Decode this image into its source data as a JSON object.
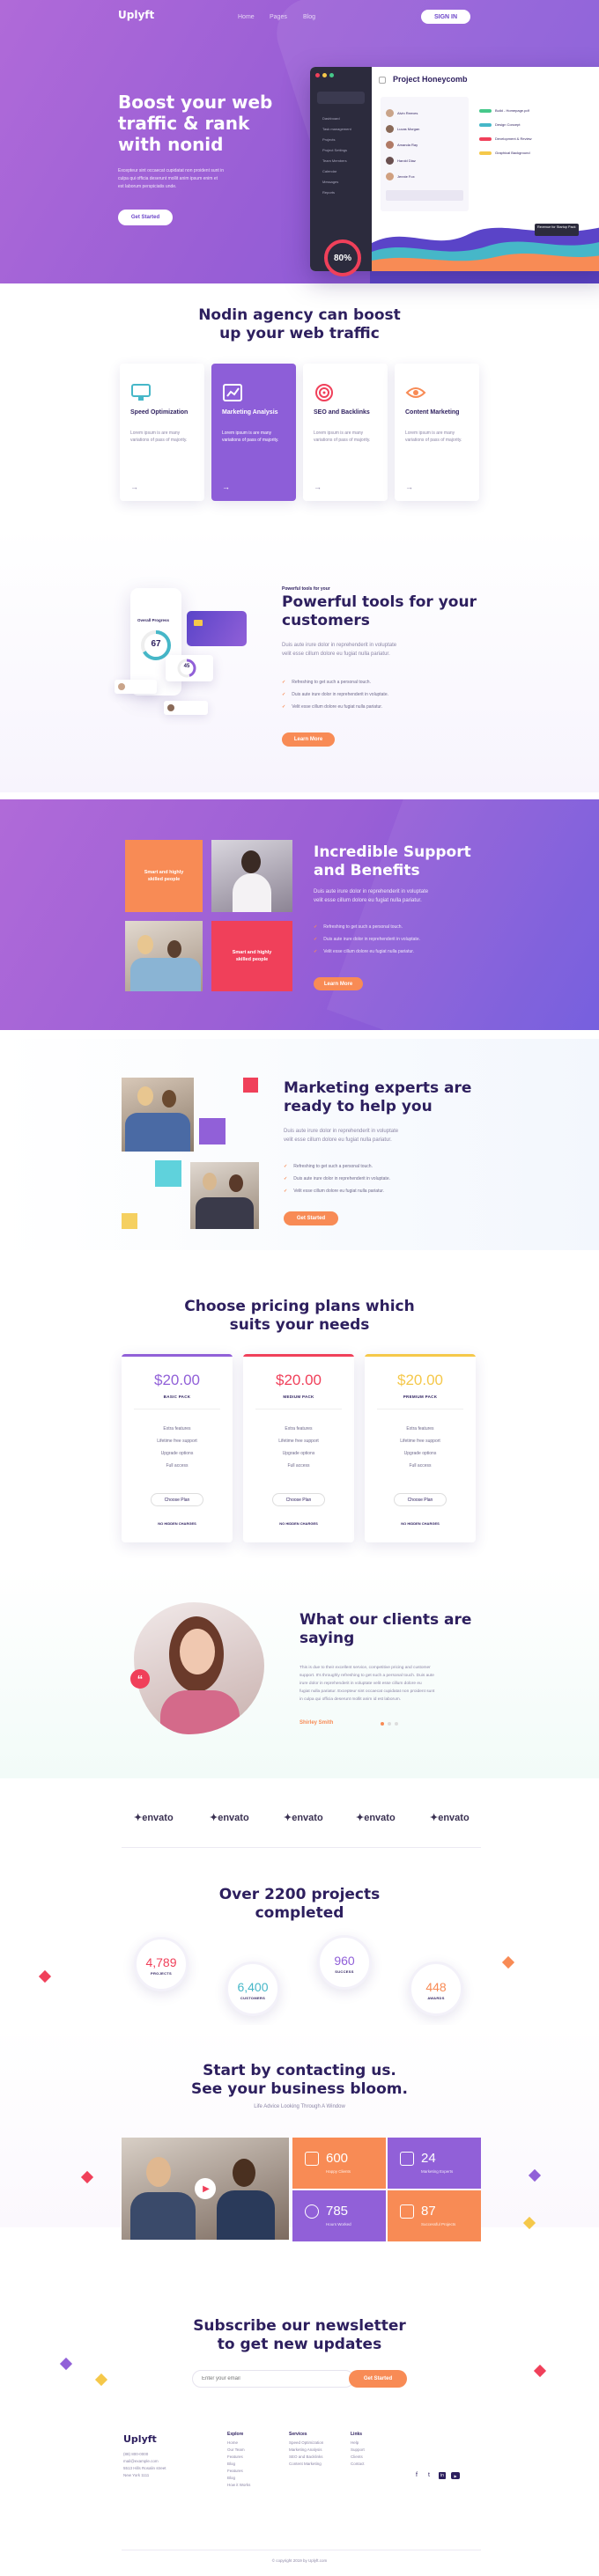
{
  "header": {
    "logo": "Uplyft",
    "nav": [
      "Home",
      "Pages",
      "Blog"
    ],
    "cta": "SIGN IN"
  },
  "hero": {
    "title_lines": [
      "Boost your web",
      "traffic & rank",
      "with nonid"
    ],
    "description_lines": [
      "Excepteur sint occaecat cupidatat non proident sunt in",
      "culpa qui officia deserunt mollit anim ipsum enim et",
      "est laborum perspiciatis unde."
    ],
    "button": "Get Started"
  },
  "dashboard": {
    "title": "Project Honeycomb",
    "sidebar_items": [
      "Dashboard",
      "Task management",
      "Projects",
      "Project Settings",
      "Team Members",
      "Calendar",
      "Messages",
      "Reports"
    ],
    "list_items": [
      "Alvin Reeves",
      "Lucas Morgan",
      "Amanda Ray",
      "Harold Diaz",
      "Jennie Fox"
    ],
    "tasks": [
      "Build - Homepage.pdf",
      "Design Concept",
      "Development & Review",
      "Graphical Background"
    ],
    "badge": "80%",
    "tooltip": "Revenue for Startup Pack"
  },
  "features": {
    "heading_lines": [
      "Nodin agency can boost",
      "up your web traffic"
    ],
    "cards": [
      {
        "title": "Speed Optimization",
        "desc": "Lorem ipsum is are many variations of pass of majority.",
        "icon": "monitor-icon",
        "active": false
      },
      {
        "title": "Marketing Analysis",
        "desc": "Lorem ipsum is are many variations of pass of majority.",
        "icon": "chart-icon",
        "active": true
      },
      {
        "title": "SEO and Backlinks",
        "desc": "Lorem ipsum is are many variations of pass of majority.",
        "icon": "target-icon",
        "active": false
      },
      {
        "title": "Content Marketing",
        "desc": "Lorem ipsum is are many variations of pass of majority.",
        "icon": "eye-icon",
        "active": false
      }
    ]
  },
  "tools": {
    "kicker": "Powerful tools for your",
    "heading_lines": [
      "Powerful tools for your",
      "customers"
    ],
    "description_lines": [
      "Duis aute irure dolor in reprehenderit in voluptate",
      "velit esse cillum dolore eu fugiat nulla pariatur."
    ],
    "list": [
      "Refreshing to get such a personal touch.",
      "Duis aute irure dolor in reprehenderit in voluptate.",
      "Velit esse cillum dolore eu fugiat nulla pariatur."
    ],
    "button": "Learn More",
    "mock_title": "Overall Progress",
    "mock_value1": "67",
    "mock_value2": "45"
  },
  "support": {
    "heading_lines": [
      "Incredible Support",
      "and Benefits"
    ],
    "description_lines": [
      "Duis aute irure dolor in reprehenderit in voluptate",
      "velit esse cillum dolore eu fugiat nulla pariatur."
    ],
    "list": [
      "Refreshing to get such a personal touch.",
      "Duis aute irure dolor in reprehenderit in voluptate.",
      "Velit esse cillum dolore eu fugiat nulla pariatur."
    ],
    "button": "Learn More",
    "tile1": "Smart and highly skilled people",
    "tile2": "Smart and highly skilled people"
  },
  "experts": {
    "heading_lines": [
      "Marketing experts are",
      "ready to help you"
    ],
    "description_lines": [
      "Duis aute irure dolor in reprehenderit in voluptate",
      "velit esse cillum dolore eu fugiat nulla pariatur."
    ],
    "list": [
      "Refreshing to get such a personal touch.",
      "Duis aute irure dolor in reprehenderit in voluptate.",
      "Velit esse cillum dolore eu fugiat nulla pariatur."
    ],
    "button": "Get Started"
  },
  "pricing": {
    "heading_lines": [
      "Choose pricing plans which",
      "suits your needs"
    ],
    "plans": [
      {
        "price": "$20.00",
        "name": "BASIC PACK",
        "color": "#9160d8",
        "price_color": "#9160d8"
      },
      {
        "price": "$20.00",
        "name": "MEDIUM PACK",
        "color": "#f0405a",
        "price_color": "#f0405a"
      },
      {
        "price": "$20.00",
        "name": "PREMIUM PACK",
        "color": "#f5c84a",
        "price_color": "#f5c84a"
      }
    ],
    "features": [
      "Extra features",
      "Lifetime free support",
      "Upgrade options",
      "Full access"
    ],
    "button": "Choose Plan",
    "note": "NO HIDDEN CHARGES"
  },
  "testimonial": {
    "heading_lines": [
      "What our clients are",
      "saying"
    ],
    "text_lines": [
      "This is due to their excellent service, competitive pricing and customer",
      "support. It's throughly refreshing to get such a personal touch. Duis aute",
      "irure dolor in reprehenderit in voluptate velit esse cillum dolore eu",
      "fugiat nulla pariatur. Excepteur sint occaecat cupidatat non proident sunt",
      "in culpa qui officia deserunt mollit anim id est laborum."
    ],
    "author": "Shirley Smith"
  },
  "brands": [
    "envato",
    "envato",
    "envato",
    "envato",
    "envato"
  ],
  "stats": {
    "heading_lines": [
      "Over 2200 projects",
      "completed"
    ],
    "items": [
      {
        "value": "4,789",
        "label": "PROJECTS",
        "color": "#f0405a"
      },
      {
        "value": "6,400",
        "label": "CUSTOMERS",
        "color": "#46b7c8"
      },
      {
        "value": "960",
        "label": "SUCCESS",
        "color": "#9160d8"
      },
      {
        "value": "448",
        "label": "AWARDS",
        "color": "#f88b55"
      }
    ]
  },
  "contact": {
    "heading_lines": [
      "Start by contacting us.",
      "See your business bloom."
    ],
    "subtitle": "Life Advice Looking Through A Window",
    "tiles": [
      {
        "value": "600",
        "label": "Happy Clients",
        "color": "#f88b55"
      },
      {
        "value": "24",
        "label": "Marketing Experts",
        "color": "#9160d8"
      },
      {
        "value": "785",
        "label": "Hours Worked",
        "color": "#9160d8"
      },
      {
        "value": "87",
        "label": "Successful Projects",
        "color": "#f88b55"
      }
    ]
  },
  "newsletter": {
    "heading_lines": [
      "Subscribe our newsletter",
      "to get new updates"
    ],
    "placeholder": "Enter your email",
    "button": "Get Started"
  },
  "footer": {
    "logo": "Uplyft",
    "contact_lines": [
      "(88) 800-0000",
      "mail@example.com",
      "5513 Hills Rosalin street",
      "New York 1111"
    ],
    "columns": [
      {
        "title": "Explore",
        "links": [
          "Home",
          "Our Team",
          "Features",
          "Blog",
          "Features",
          "Blog",
          "How it Works"
        ]
      },
      {
        "title": "Services",
        "links": [
          "Speed Optimization",
          "Marketing Analysis",
          "SEO and Backlinks",
          "Content Marketing"
        ]
      },
      {
        "title": "Links",
        "links": [
          "Help",
          "Support",
          "Clients",
          "Contact"
        ]
      }
    ],
    "copyright": "© copyright 2019 by Uplyft.com"
  },
  "colors": {
    "purple": "#9160d8",
    "orange": "#f88b55",
    "red": "#f0405a",
    "navy": "#2d1f5e"
  }
}
